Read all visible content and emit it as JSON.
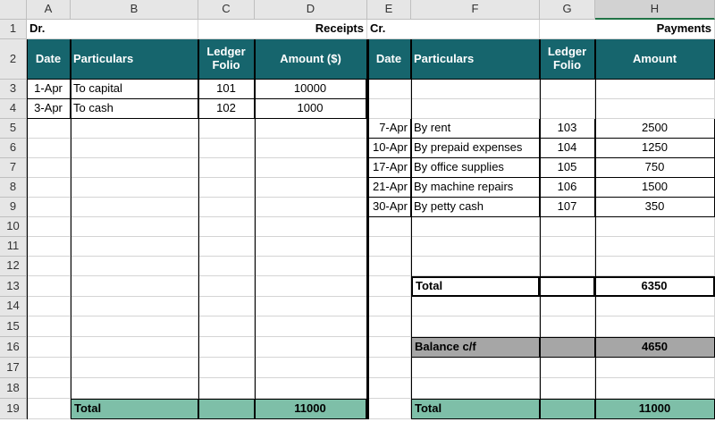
{
  "columns": [
    "A",
    "B",
    "C",
    "D",
    "E",
    "F",
    "G",
    "H"
  ],
  "rows": [
    "1",
    "2",
    "3",
    "4",
    "5",
    "6",
    "7",
    "8",
    "9",
    "10",
    "11",
    "12",
    "13",
    "14",
    "15",
    "16",
    "17",
    "18",
    "19"
  ],
  "top_labels": {
    "dr": "Dr.",
    "receipts": "Receipts",
    "cr": "Cr.",
    "payments": "Payments"
  },
  "headers": {
    "left": [
      "Date",
      "Particulars",
      "Ledger Folio",
      "Amount ($)"
    ],
    "right": [
      "Date",
      "Particulars",
      "Ledger Folio",
      "Amount"
    ]
  },
  "receipts": [
    {
      "date": "1-Apr",
      "particulars": "To capital",
      "folio": "101",
      "amount": "10000"
    },
    {
      "date": "3-Apr",
      "particulars": "To cash",
      "folio": "102",
      "amount": "1000"
    }
  ],
  "payments": [
    {
      "date": "7-Apr",
      "particulars": "By rent",
      "folio": "103",
      "amount": "2500"
    },
    {
      "date": "10-Apr",
      "particulars": "By prepaid expenses",
      "folio": "104",
      "amount": "1250"
    },
    {
      "date": "17-Apr",
      "particulars": "By office supplies",
      "folio": "105",
      "amount": "750"
    },
    {
      "date": "21-Apr",
      "particulars": "By machine repairs",
      "folio": "106",
      "amount": "1500"
    },
    {
      "date": "30-Apr",
      "particulars": "By petty cash",
      "folio": "107",
      "amount": "350"
    }
  ],
  "right_total": {
    "label": "Total",
    "amount": "6350"
  },
  "balance": {
    "label": "Balance c/f",
    "amount": "4650"
  },
  "final": {
    "left_label": "Total",
    "left_amount": "11000",
    "right_label": "Total",
    "right_amount": "11000"
  },
  "colors": {
    "header_bg": "#16656d",
    "total_bg": "#7ebfa8",
    "balance_bg": "#a6a6a6",
    "selected_column_header": "#d2d2d2"
  },
  "selected_column": "H"
}
